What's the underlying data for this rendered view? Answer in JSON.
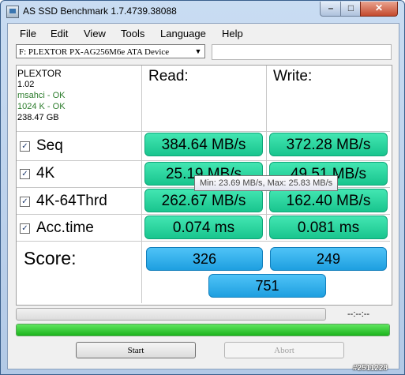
{
  "window": {
    "title": "AS SSD Benchmark 1.7.4739.38088"
  },
  "menu": [
    "File",
    "Edit",
    "View",
    "Tools",
    "Language",
    "Help"
  ],
  "drive": {
    "selected": "F: PLEXTOR PX-AG256M6e ATA Device"
  },
  "info": {
    "brand": "PLEXTOR",
    "firmware": "1.02",
    "driver": "msahci - OK",
    "alignment": "1024 K - OK",
    "size": "238.47 GB"
  },
  "headers": {
    "read": "Read:",
    "write": "Write:"
  },
  "rows": [
    {
      "label": "Seq",
      "checked": true,
      "read": "384.64 MB/s",
      "write": "372.28 MB/s"
    },
    {
      "label": "4K",
      "checked": true,
      "read": "25.19 MB/s",
      "write": "49.51 MB/s"
    },
    {
      "label": "4K-64Thrd",
      "checked": true,
      "read": "262.67 MB/s",
      "write": "162.40 MB/s"
    },
    {
      "label": "Acc.time",
      "checked": true,
      "read": "0.074 ms",
      "write": "0.081 ms"
    }
  ],
  "score": {
    "label": "Score:",
    "read": "326",
    "write": "249",
    "total": "751"
  },
  "tooltip": "Min: 23.69 MB/s, Max: 25.83 MB/s",
  "progress": {
    "current": 0,
    "overall": 1.0,
    "time": "--:--:--"
  },
  "buttons": {
    "start": "Start",
    "abort": "Abort"
  },
  "watermark": "#2511228",
  "colors": {
    "result": "#2fd9a0",
    "score": "#2fb2ec",
    "progress": "#2fcb2f"
  }
}
